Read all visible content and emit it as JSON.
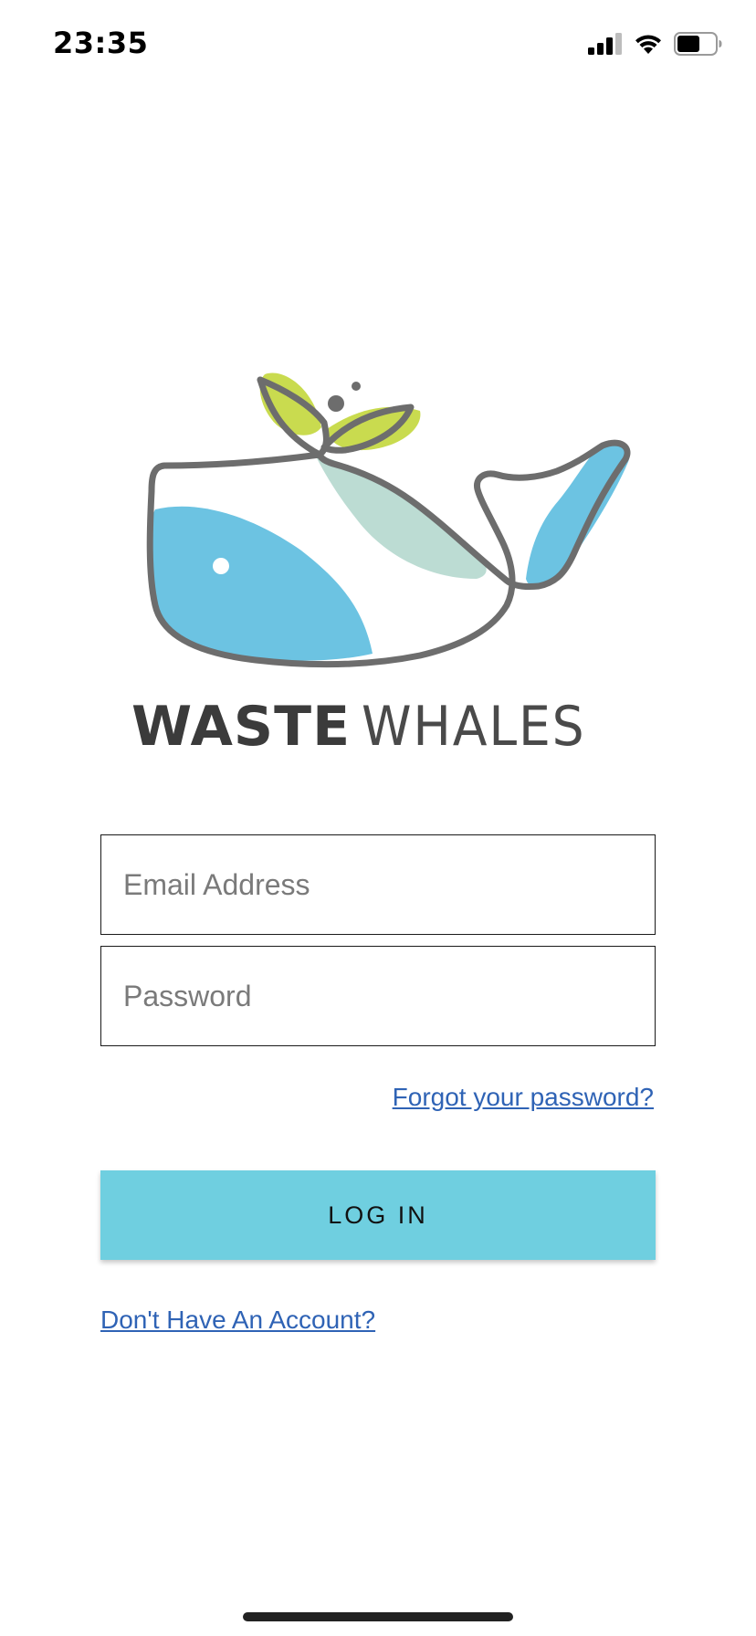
{
  "status_bar": {
    "time": "23:35",
    "icons": [
      "cellular-signal-icon",
      "wifi-icon",
      "battery-icon"
    ],
    "battery_level": 0.6
  },
  "logo": {
    "name": "whale-logo",
    "wordmark_bold": "WASTE",
    "wordmark_light": "WHALES",
    "colors": {
      "outline": "#6d6d6d",
      "blue": "#6cc3e2",
      "green": "#c9db4f",
      "teal": "#bcdcd3"
    }
  },
  "form": {
    "email_placeholder": "Email Address",
    "email_value": "",
    "password_placeholder": "Password",
    "password_value": "",
    "forgot_label": "Forgot your password?",
    "login_label": "LOG IN",
    "signup_label": "Don't Have An Account?"
  },
  "colors": {
    "accent": "#6fcfe0",
    "link": "#2f63b5"
  }
}
